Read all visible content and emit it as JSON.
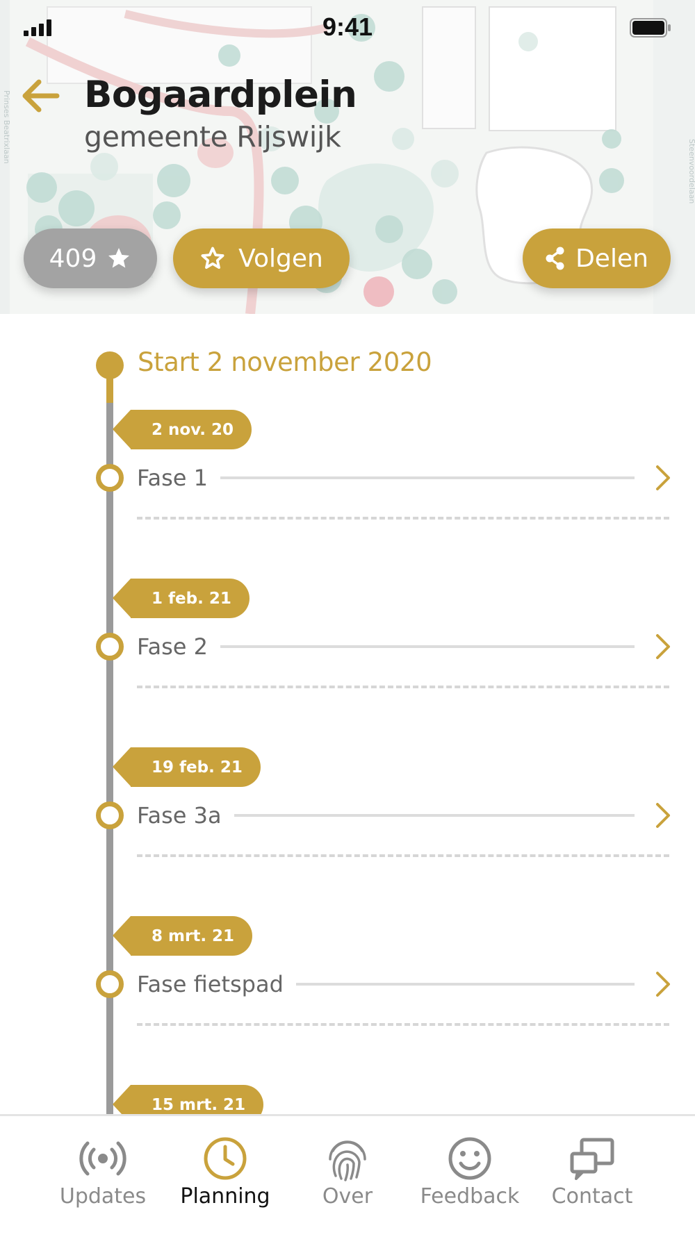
{
  "status_bar": {
    "time": "9:41"
  },
  "header": {
    "title": "Bogaardplein",
    "subtitle": "gemeente Rijswijk",
    "back_icon": "arrow-left-icon",
    "map_street_labels": [
      "Prinses Beatrixlaan",
      "Steenvoordelaan"
    ]
  },
  "actions": {
    "count": "409",
    "follow_label": "Volgen",
    "share_label": "Delen"
  },
  "timeline": {
    "start_label": "Start 2 november 2020",
    "phases": [
      {
        "date": "2 nov. 20",
        "label": "Fase 1"
      },
      {
        "date": "1 feb. 21",
        "label": "Fase 2"
      },
      {
        "date": "19 feb. 21",
        "label": "Fase 3a"
      },
      {
        "date": "8 mrt. 21",
        "label": "Fase fietspad"
      },
      {
        "date": "15 mrt. 21",
        "label": ""
      }
    ]
  },
  "tabbar": {
    "items": [
      {
        "label": "Updates",
        "icon": "broadcast-icon",
        "active": false
      },
      {
        "label": "Planning",
        "icon": "clock-icon",
        "active": true
      },
      {
        "label": "Over",
        "icon": "fingerprint-icon",
        "active": false
      },
      {
        "label": "Feedback",
        "icon": "smiley-icon",
        "active": false
      },
      {
        "label": "Contact",
        "icon": "chat-screens-icon",
        "active": false
      }
    ]
  },
  "colors": {
    "accent": "#c9a23c",
    "grey_pill": "#a3a3a3",
    "rail": "#9a9a9a"
  }
}
